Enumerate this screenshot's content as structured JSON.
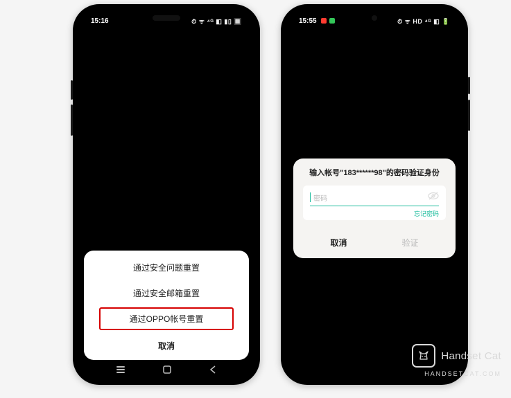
{
  "left_phone": {
    "status": {
      "time": "15:16",
      "tray": "⏱ ᯤ ⁴ᴳ ◧ ▮▯ 🔲"
    },
    "sheet": {
      "options": [
        "通过安全问题重置",
        "通过安全邮箱重置",
        "通过OPPO帐号重置"
      ],
      "highlight_index": 2,
      "cancel": "取消"
    }
  },
  "right_phone": {
    "status": {
      "time": "15:55",
      "dot_colors": [
        "#ff3b30",
        "#34c759"
      ],
      "tray": "⏱ ᯤ HD ⁴ᴳ ◧ 🔋"
    },
    "dialog": {
      "title_prefix": "输入帐号\"",
      "account": "183******98",
      "title_suffix": "\"的密码验证身份",
      "password_placeholder": "密码",
      "forgot": "忘记密码",
      "cancel": "取消",
      "confirm": "验证"
    }
  },
  "watermark": {
    "name": "Handset Cat",
    "sub": "HANDSETCAT.COM"
  }
}
